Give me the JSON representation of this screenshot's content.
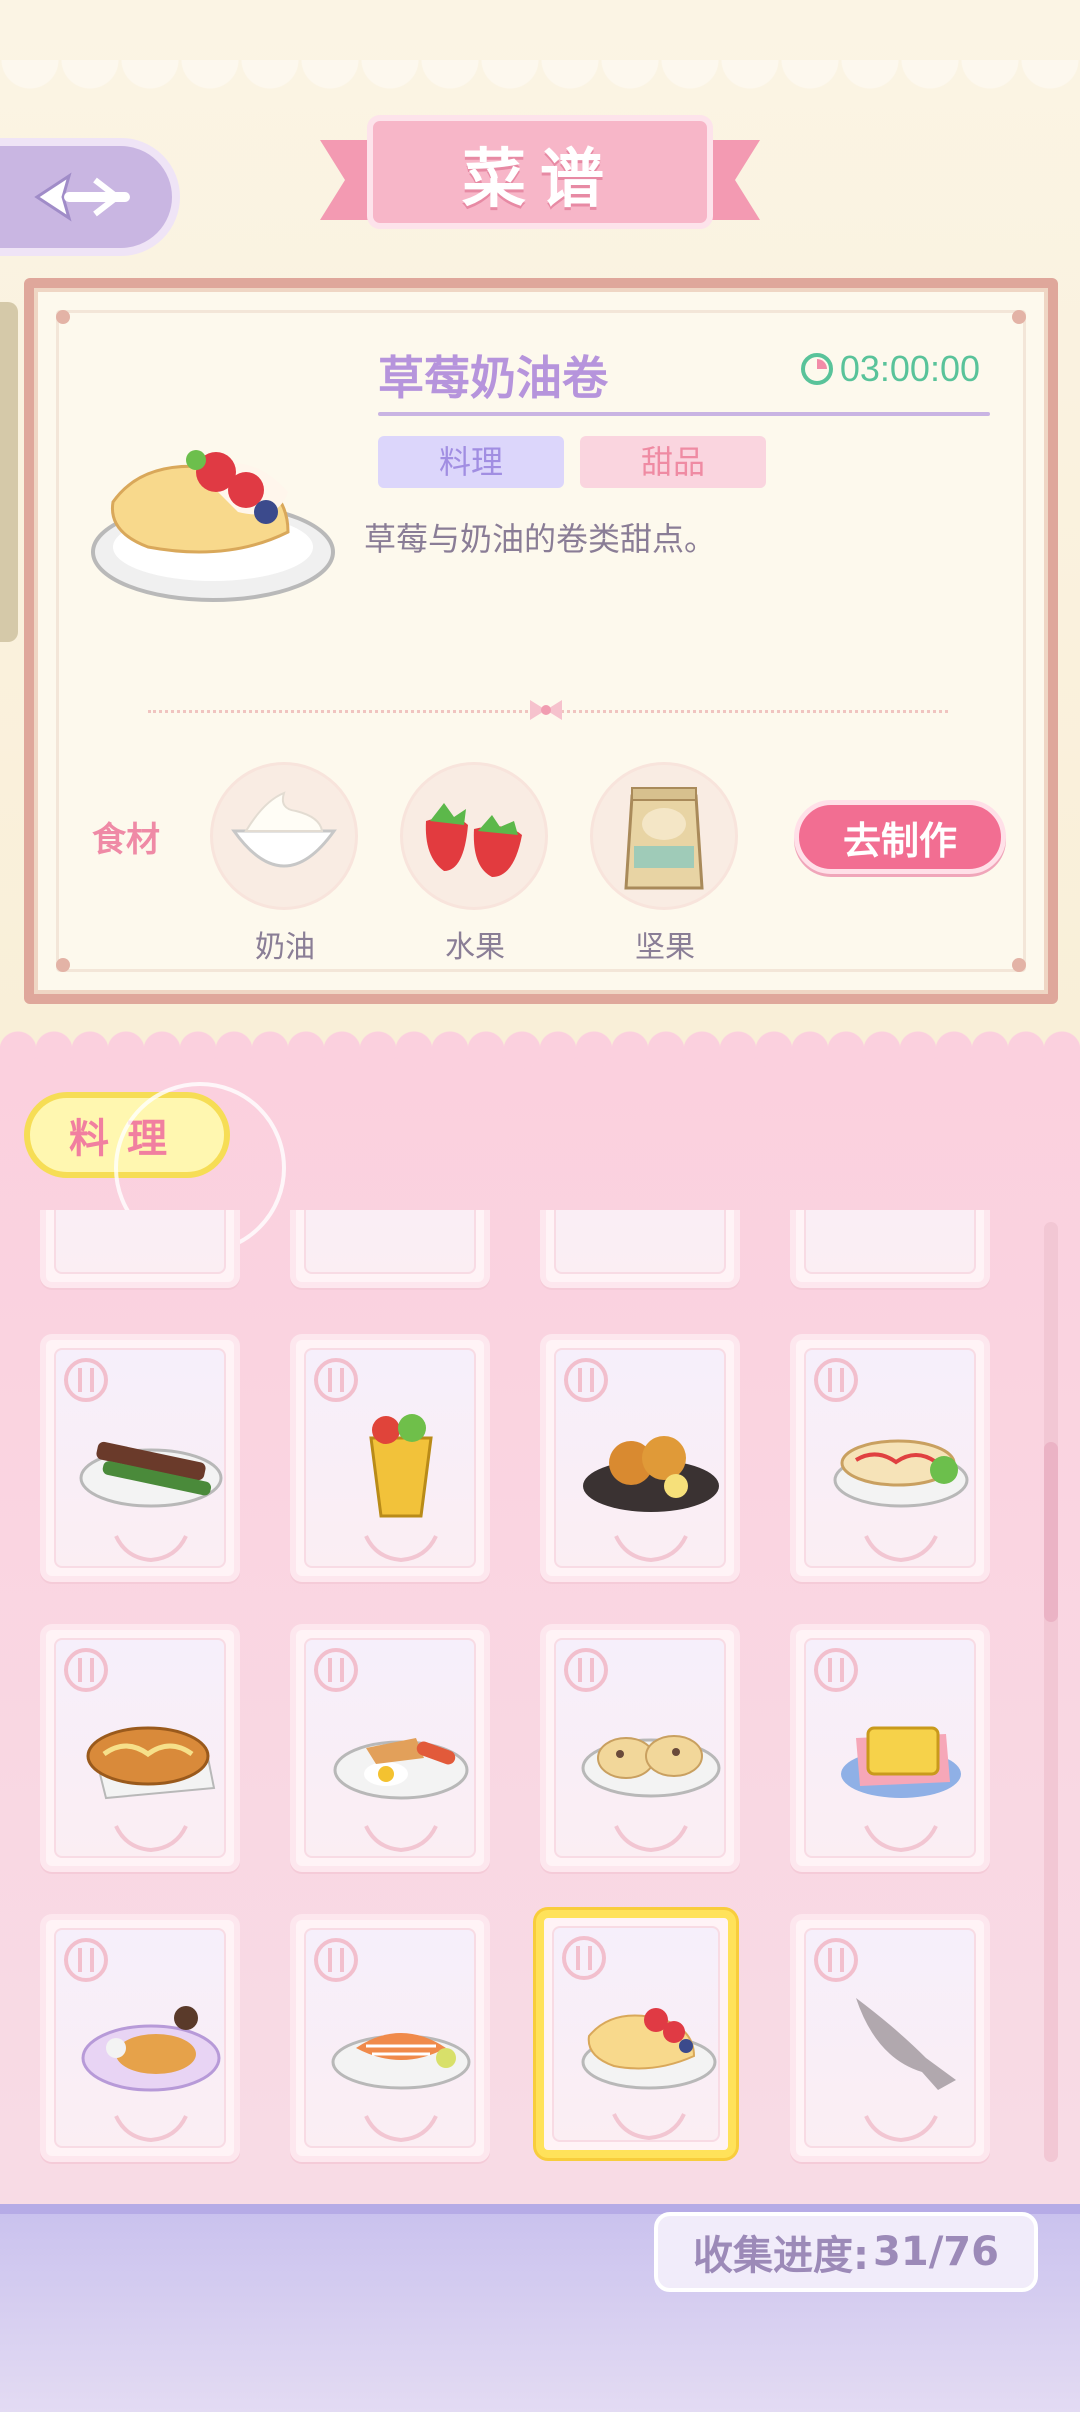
{
  "header": {
    "title": "菜谱",
    "back_icon": "back-arrow-icon"
  },
  "recipe": {
    "name": "草莓奶油卷",
    "timer": "03:00:00",
    "tags": [
      "料理",
      "甜品"
    ],
    "description": "草莓与奶油的卷类甜点。",
    "ingredients_label": "食材",
    "ingredients": [
      {
        "name": "奶油",
        "icon": "cream-icon"
      },
      {
        "name": "水果",
        "icon": "strawberry-icon"
      },
      {
        "name": "坚果",
        "icon": "nuts-bag-icon"
      }
    ],
    "make_button": "去制作"
  },
  "category_tab": "料理",
  "grid": {
    "rows": [
      [
        "partial-dish",
        "partial-dish",
        "partial-dish",
        "partial-dish"
      ],
      [
        "kebab",
        "wrap",
        "fried-chicken",
        "burrito"
      ],
      [
        "hotdog-bun",
        "breakfast-plate",
        "cookies",
        "toast"
      ],
      [
        "fried-platter",
        "salmon-sashimi",
        "strawberry-cream-roll",
        "locked-fish"
      ]
    ],
    "selected": "strawberry-cream-roll"
  },
  "progress": {
    "label": "收集进度:",
    "value": "31/76"
  },
  "colors": {
    "accent_pink": "#f26e92",
    "lavender": "#b694dc",
    "timer_green": "#59c39a",
    "highlight_yellow": "#ffe25a"
  }
}
